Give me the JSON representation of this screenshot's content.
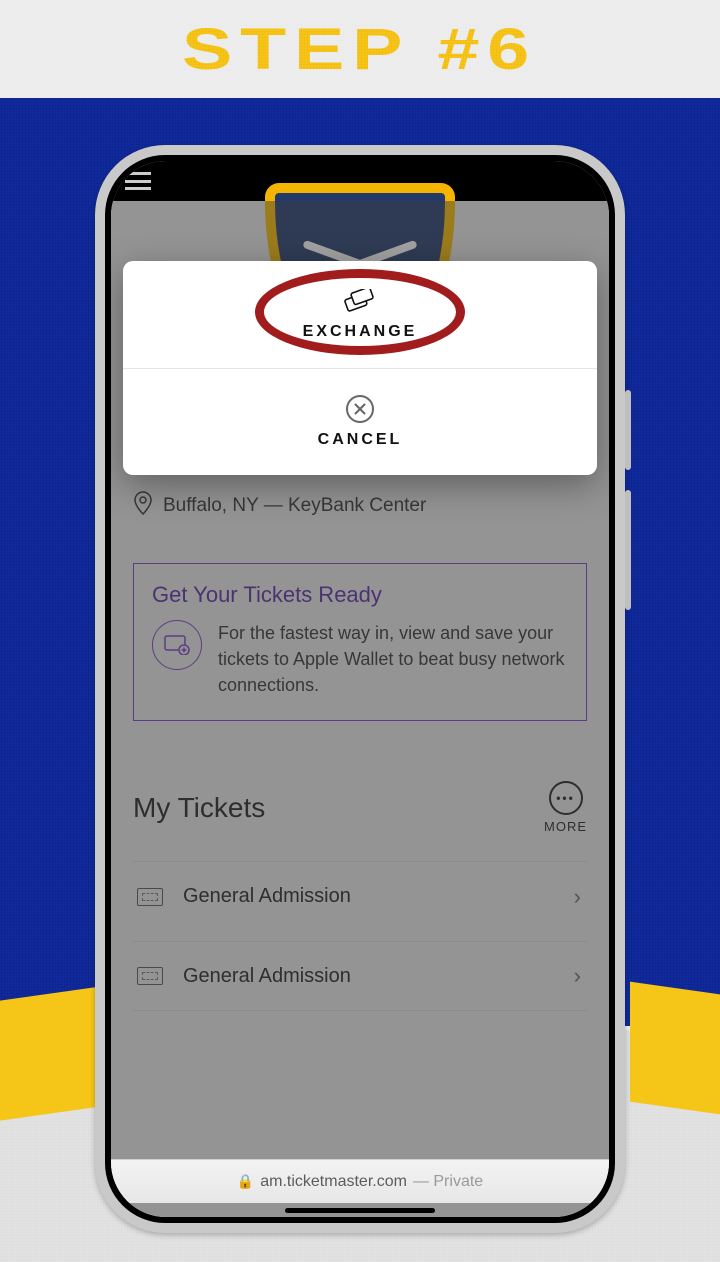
{
  "header": {
    "title": "STEP #6"
  },
  "modal": {
    "exchange_label": "EXCHANGE",
    "cancel_label": "CANCEL"
  },
  "location": {
    "text": "Buffalo, NY — KeyBank Center"
  },
  "ready": {
    "title": "Get Your Tickets Ready",
    "body": "For the fastest way in, view and save your tickets to Apple Wallet to beat busy network connections."
  },
  "my_tickets": {
    "heading": "My Tickets",
    "more_label": "MORE",
    "items": [
      {
        "label": "General Admission"
      },
      {
        "label": "General Admission"
      }
    ]
  },
  "safari": {
    "domain": "am.ticketmaster.com",
    "mode": "— Private"
  }
}
